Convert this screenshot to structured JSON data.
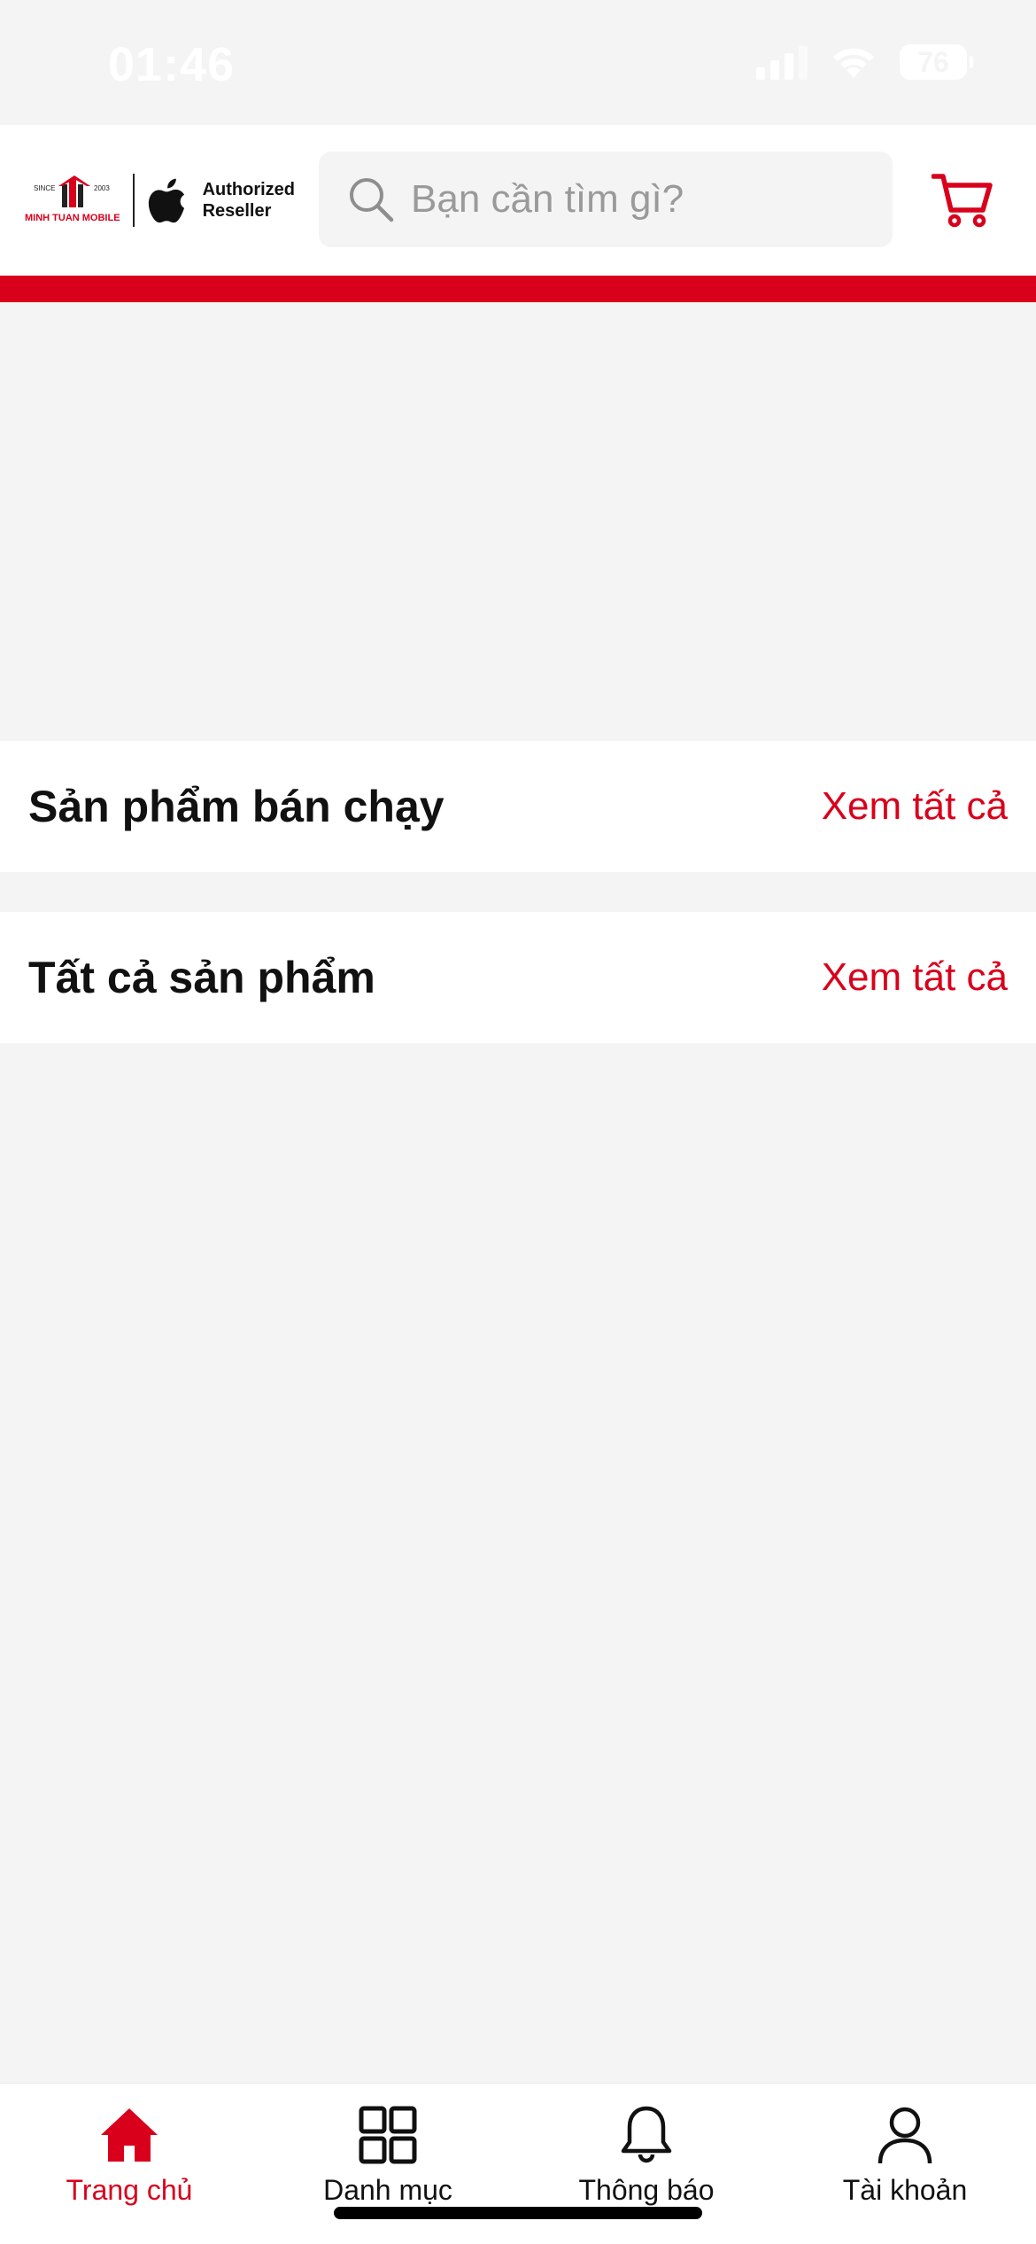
{
  "status_bar": {
    "time": "01:46",
    "battery": "76"
  },
  "header": {
    "logo": {
      "brand_name": "MINH TUAN MOBILE",
      "since_label": "SINCE",
      "year_label": "2003",
      "authorized_line1": "Authorized",
      "authorized_line2": "Reseller"
    },
    "search": {
      "placeholder": "Bạn cần tìm gì?"
    },
    "colors": {
      "accent": "#d9001b"
    }
  },
  "sections": [
    {
      "title": "Sản phẩm bán chạy",
      "link": "Xem tất cả"
    },
    {
      "title": "Tất cả sản phẩm",
      "link": "Xem tất cả"
    }
  ],
  "tab_bar": {
    "items": [
      {
        "label": "Trang chủ",
        "icon": "home-icon",
        "active": true
      },
      {
        "label": "Danh mục",
        "icon": "grid-icon",
        "active": false
      },
      {
        "label": "Thông báo",
        "icon": "bell-icon",
        "active": false
      },
      {
        "label": "Tài khoản",
        "icon": "user-icon",
        "active": false
      }
    ]
  }
}
